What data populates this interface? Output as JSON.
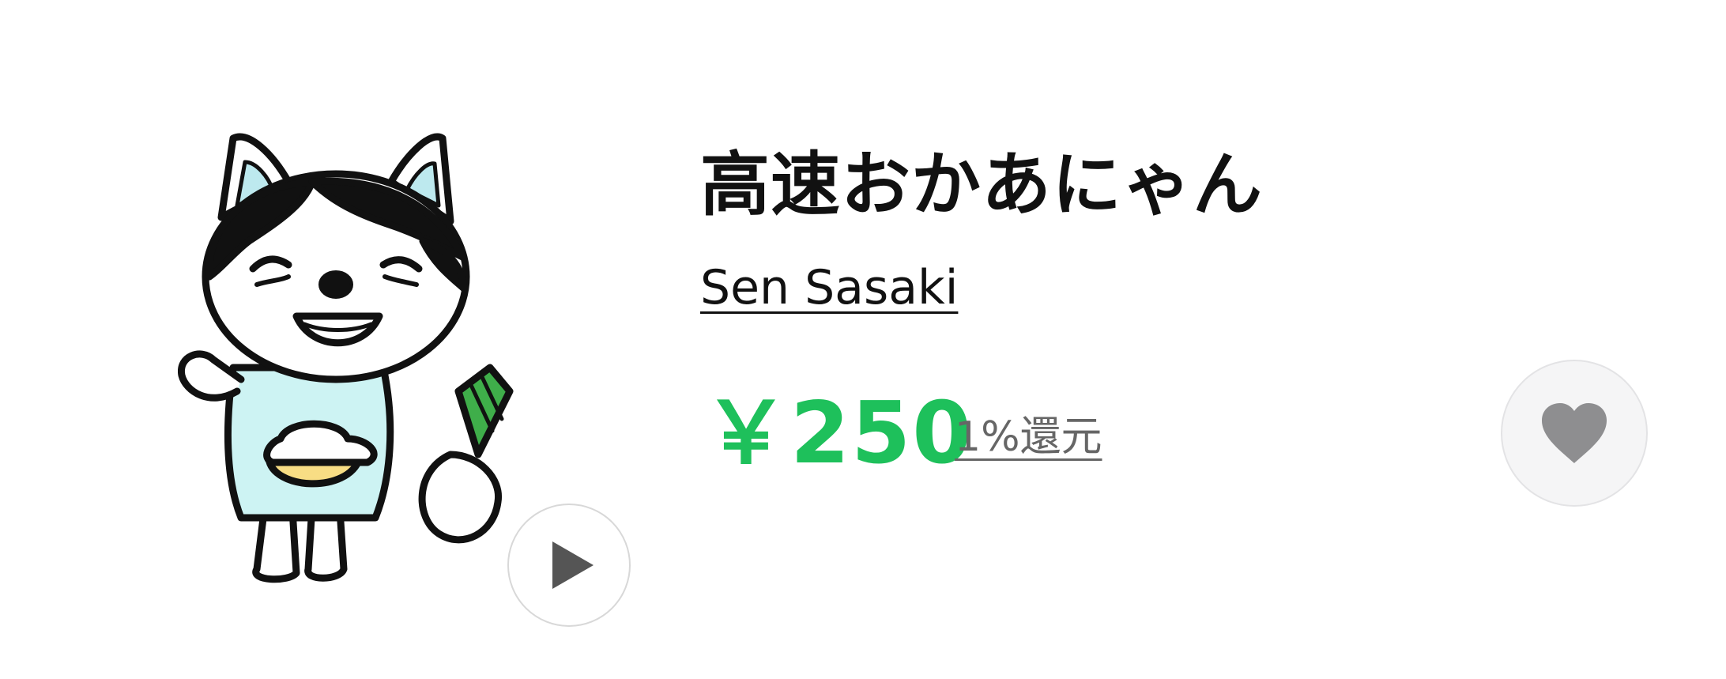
{
  "product": {
    "title": "高速おかあにゃん",
    "author": "Sen Sasaki",
    "price": "￥250",
    "cashback": "1%還元"
  },
  "icons": {
    "sticker": "cat-mom-sticker-image",
    "play": "play-icon",
    "favorite": "heart-icon"
  },
  "colors": {
    "price": "#1ec05b",
    "heart": "#8e8e90",
    "fav_bg": "#f5f5f6",
    "play": "#555555"
  }
}
